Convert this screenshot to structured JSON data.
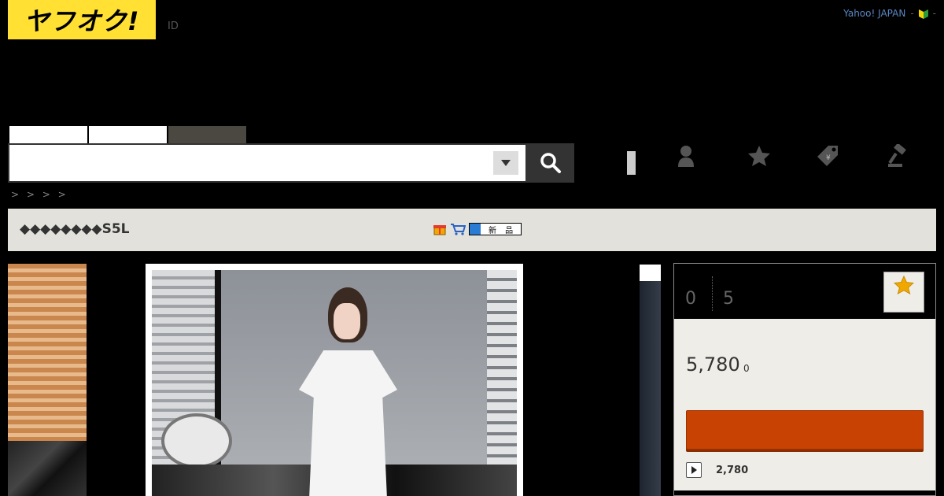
{
  "header": {
    "logo_text": "ヤフオク!",
    "id_label": "ID",
    "yahoo_link": "Yahoo! JAPAN",
    "sep": "-",
    "sep2": "-"
  },
  "search": {
    "value": "",
    "placeholder": ""
  },
  "breadcrumb": "> > > >",
  "item": {
    "title": "◆◆◆◆◆◆◆◆S5L",
    "new_badge": "新 品"
  },
  "bid_panel": {
    "bid_count": "0",
    "time_left": "5",
    "current_price": "5,780",
    "price_suffix": "0",
    "buy_now_price": "2,780"
  },
  "colors": {
    "logo_yellow": "#ffe033",
    "bid_button": "#c84303",
    "title_bar": "#e3e1db"
  }
}
